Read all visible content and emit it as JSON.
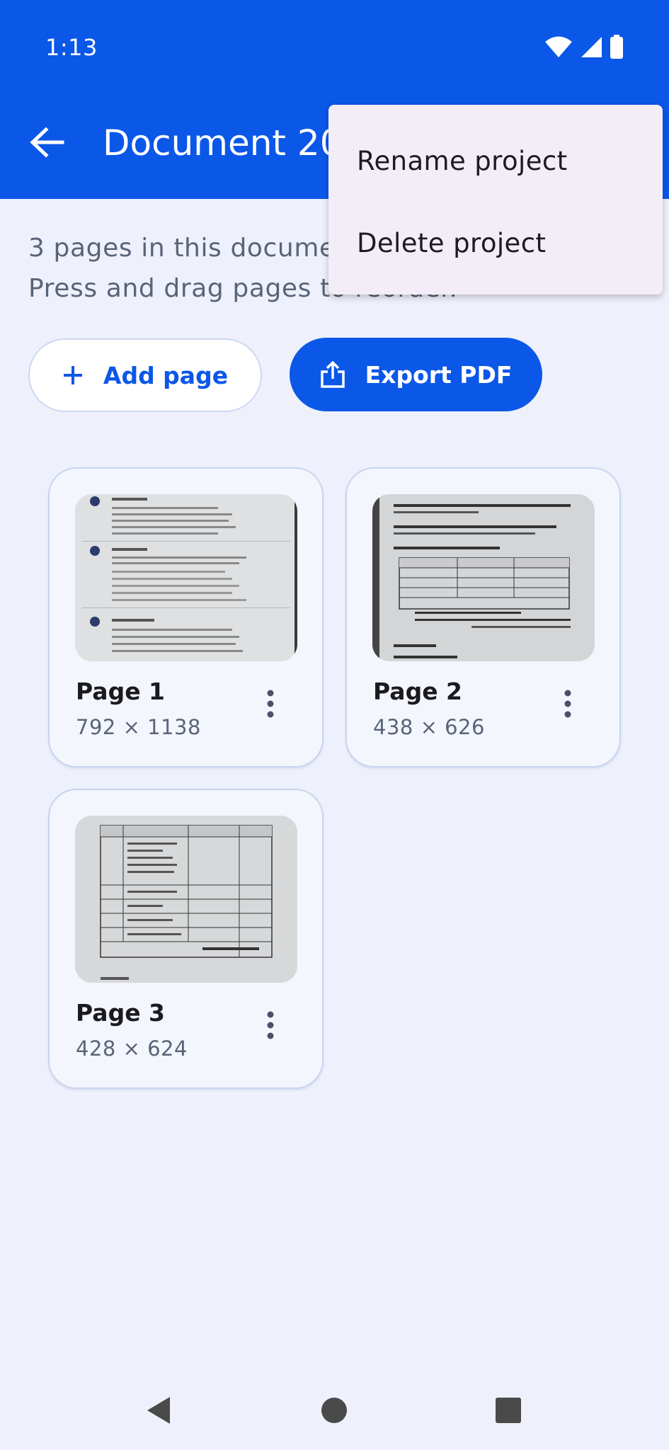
{
  "status_bar": {
    "time": "1:13"
  },
  "app_bar": {
    "title": "Document 20"
  },
  "info": {
    "line1": "3 pages in this document.",
    "line2": "Press and drag pages to reorder."
  },
  "actions": {
    "add_label": "Add page",
    "export_label": "Export PDF"
  },
  "pages": [
    {
      "title": "Page 1",
      "dims": "792 × 1138"
    },
    {
      "title": "Page 2",
      "dims": "438 × 626"
    },
    {
      "title": "Page 3",
      "dims": "428 × 624"
    }
  ],
  "menu": {
    "rename": "Rename project",
    "delete": "Delete project"
  },
  "colors": {
    "primary": "#0b57e8",
    "background": "#eef1fb",
    "menu_bg": "#f3edf7"
  }
}
